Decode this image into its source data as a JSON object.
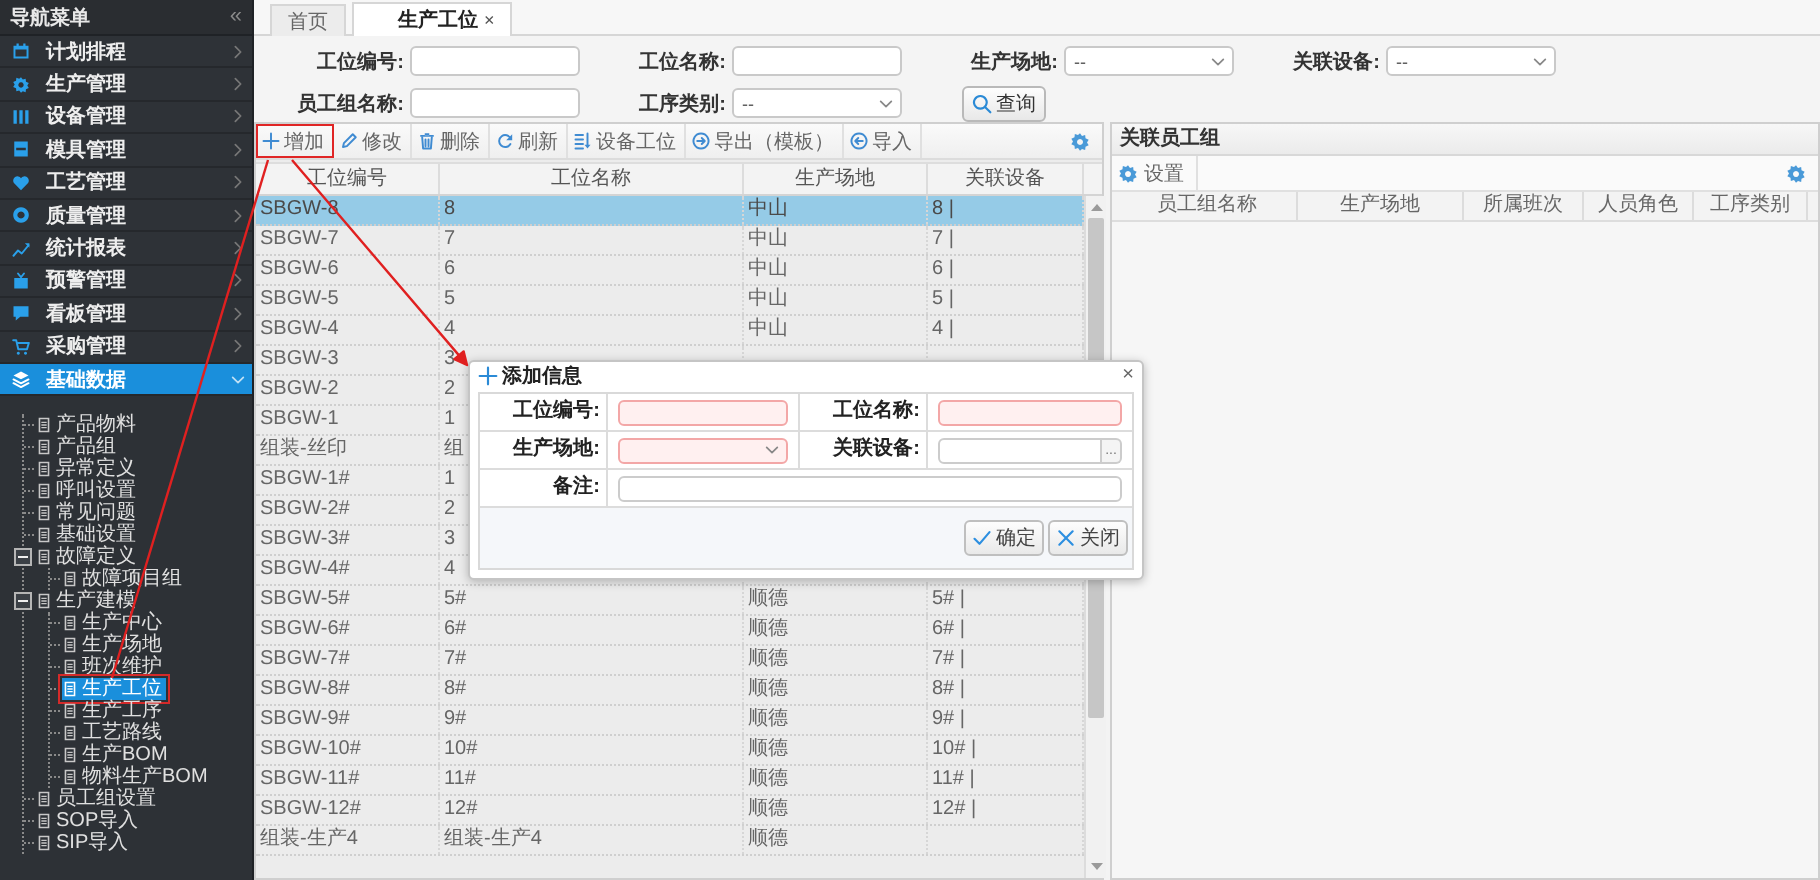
{
  "sidebar": {
    "title": "导航菜单",
    "collapse": "«",
    "menu": [
      {
        "label": "计划排程",
        "selected": false,
        "expanded": false
      },
      {
        "label": "生产管理",
        "selected": false,
        "expanded": false
      },
      {
        "label": "设备管理",
        "selected": false,
        "expanded": false
      },
      {
        "label": "模具管理",
        "selected": false,
        "expanded": false
      },
      {
        "label": "工艺管理",
        "selected": false,
        "expanded": false
      },
      {
        "label": "质量管理",
        "selected": false,
        "expanded": false
      },
      {
        "label": "统计报表",
        "selected": false,
        "expanded": false
      },
      {
        "label": "预警管理",
        "selected": false,
        "expanded": false
      },
      {
        "label": "看板管理",
        "selected": false,
        "expanded": false
      },
      {
        "label": "采购管理",
        "selected": false,
        "expanded": false
      },
      {
        "label": "基础数据",
        "selected": true,
        "expanded": true,
        "children": [
          {
            "label": "产品物料",
            "selected": false,
            "highlighted": false
          },
          {
            "label": "产品组",
            "selected": false,
            "highlighted": false
          },
          {
            "label": "异常定义",
            "selected": false,
            "highlighted": false
          },
          {
            "label": "呼叫设置",
            "selected": false,
            "highlighted": false
          },
          {
            "label": "常见问题",
            "selected": false,
            "highlighted": false
          },
          {
            "label": "基础设置",
            "selected": false,
            "highlighted": false
          },
          {
            "label": "故障定义",
            "selected": false,
            "highlighted": false,
            "expanded": true,
            "children": [
              {
                "label": "故障项目组",
                "selected": false,
                "highlighted": false
              }
            ]
          },
          {
            "label": "生产建模",
            "selected": false,
            "highlighted": false,
            "expanded": true,
            "children": [
              {
                "label": "生产中心",
                "selected": false,
                "highlighted": false
              },
              {
                "label": "生产场地",
                "selected": false,
                "highlighted": false
              },
              {
                "label": "班次维护",
                "selected": false,
                "highlighted": false
              },
              {
                "label": "生产工位",
                "selected": true,
                "highlighted": true
              },
              {
                "label": "生产工序",
                "selected": false,
                "highlighted": false
              },
              {
                "label": "工艺路线",
                "selected": false,
                "highlighted": false
              },
              {
                "label": "生产BOM",
                "selected": false,
                "highlighted": false
              },
              {
                "label": "物料生产BOM",
                "selected": false,
                "highlighted": false
              }
            ]
          },
          {
            "label": "员工组设置",
            "selected": false,
            "highlighted": false
          },
          {
            "label": "SOP导入",
            "selected": false,
            "highlighted": false
          },
          {
            "label": "SIP导入",
            "selected": false,
            "highlighted": false
          }
        ]
      }
    ]
  },
  "tabs": [
    {
      "label": "首页",
      "selected": false
    },
    {
      "label": "生产工位",
      "selected": true,
      "close": "×"
    }
  ],
  "search_form": {
    "fields": [
      {
        "label": "工位编号:",
        "kind": "input"
      },
      {
        "label": "工位名称:",
        "kind": "input"
      },
      {
        "label": "生产场地:",
        "kind": "select",
        "value": "--"
      },
      {
        "label": "关联设备:",
        "kind": "select",
        "value": "--"
      },
      {
        "label": "员工组名称:",
        "kind": "input"
      },
      {
        "label": "工序类别:",
        "kind": "select",
        "value": "--"
      }
    ],
    "search_button": "查询"
  },
  "stations_grid": {
    "toolbar": [
      {
        "label": "增加",
        "highlighted": true
      },
      {
        "label": "修改",
        "highlighted": false
      },
      {
        "label": "删除",
        "highlighted": false
      },
      {
        "label": "刷新",
        "highlighted": false
      },
      {
        "label": "设备工位",
        "highlighted": false
      },
      {
        "label": "导出（模板）",
        "highlighted": false
      },
      {
        "label": "导入",
        "highlighted": false
      }
    ],
    "columns": [
      "工位编号",
      "工位名称",
      "生产场地",
      "关联设备"
    ],
    "rows": [
      {
        "cells": [
          "SBGW-8",
          "8",
          "中山",
          "8 |"
        ],
        "selected": true
      },
      {
        "cells": [
          "SBGW-7",
          "7",
          "中山",
          "7 |"
        ],
        "selected": false
      },
      {
        "cells": [
          "SBGW-6",
          "6",
          "中山",
          "6 |"
        ],
        "selected": false
      },
      {
        "cells": [
          "SBGW-5",
          "5",
          "中山",
          "5 |"
        ],
        "selected": false
      },
      {
        "cells": [
          "SBGW-4",
          "4",
          "中山",
          "4 |"
        ],
        "selected": false
      },
      {
        "cells": [
          "SBGW-3",
          "3"
        ],
        "selected": false
      },
      {
        "cells": [
          "SBGW-2",
          "2"
        ],
        "selected": false
      },
      {
        "cells": [
          "SBGW-1",
          "1"
        ],
        "selected": false
      },
      {
        "cells": [
          "组装-丝印",
          "组"
        ],
        "selected": false
      },
      {
        "cells": [
          "SBGW-1#",
          "1"
        ],
        "selected": false
      },
      {
        "cells": [
          "SBGW-2#",
          "2"
        ],
        "selected": false
      },
      {
        "cells": [
          "SBGW-3#",
          "3"
        ],
        "selected": false
      },
      {
        "cells": [
          "SBGW-4#",
          "4"
        ],
        "selected": false
      },
      {
        "cells": [
          "SBGW-5#",
          "5#",
          "顺德",
          "5# |"
        ],
        "selected": false
      },
      {
        "cells": [
          "SBGW-6#",
          "6#",
          "顺德",
          "6# |"
        ],
        "selected": false
      },
      {
        "cells": [
          "SBGW-7#",
          "7#",
          "顺德",
          "7# |"
        ],
        "selected": false
      },
      {
        "cells": [
          "SBGW-8#",
          "8#",
          "顺德",
          "8# |"
        ],
        "selected": false
      },
      {
        "cells": [
          "SBGW-9#",
          "9#",
          "顺德",
          "9# |"
        ],
        "selected": false
      },
      {
        "cells": [
          "SBGW-10#",
          "10#",
          "顺德",
          "10# |"
        ],
        "selected": false
      },
      {
        "cells": [
          "SBGW-11#",
          "11#",
          "顺德",
          "11# |"
        ],
        "selected": false
      },
      {
        "cells": [
          "SBGW-12#",
          "12#",
          "顺德",
          "12# |"
        ],
        "selected": false
      },
      {
        "cells": [
          "组装-生产4",
          "组装-生产4",
          "顺德"
        ],
        "selected": false
      }
    ]
  },
  "employee_groups": {
    "title": "关联员工组",
    "settings_button": "设置",
    "columns": [
      "员工组名称",
      "生产场地",
      "所属班次",
      "人员角色",
      "工序类别"
    ]
  },
  "dialog": {
    "title": "添加信息",
    "close": "×",
    "rows": [
      [
        {
          "label": "工位编号:",
          "kind": "input",
          "invalid": true
        },
        {
          "label": "工位名称:",
          "kind": "input",
          "invalid": true
        }
      ],
      [
        {
          "label": "生产场地:",
          "kind": "select",
          "invalid": true
        },
        {
          "label": "关联设备:",
          "kind": "picker",
          "invalid": false,
          "button": "..."
        }
      ],
      [
        {
          "label": "备注:",
          "kind": "input",
          "invalid": false
        }
      ]
    ],
    "buttons": [
      {
        "label": "确定",
        "kind": "confirm"
      },
      {
        "label": "关闭",
        "kind": "close"
      }
    ]
  }
}
